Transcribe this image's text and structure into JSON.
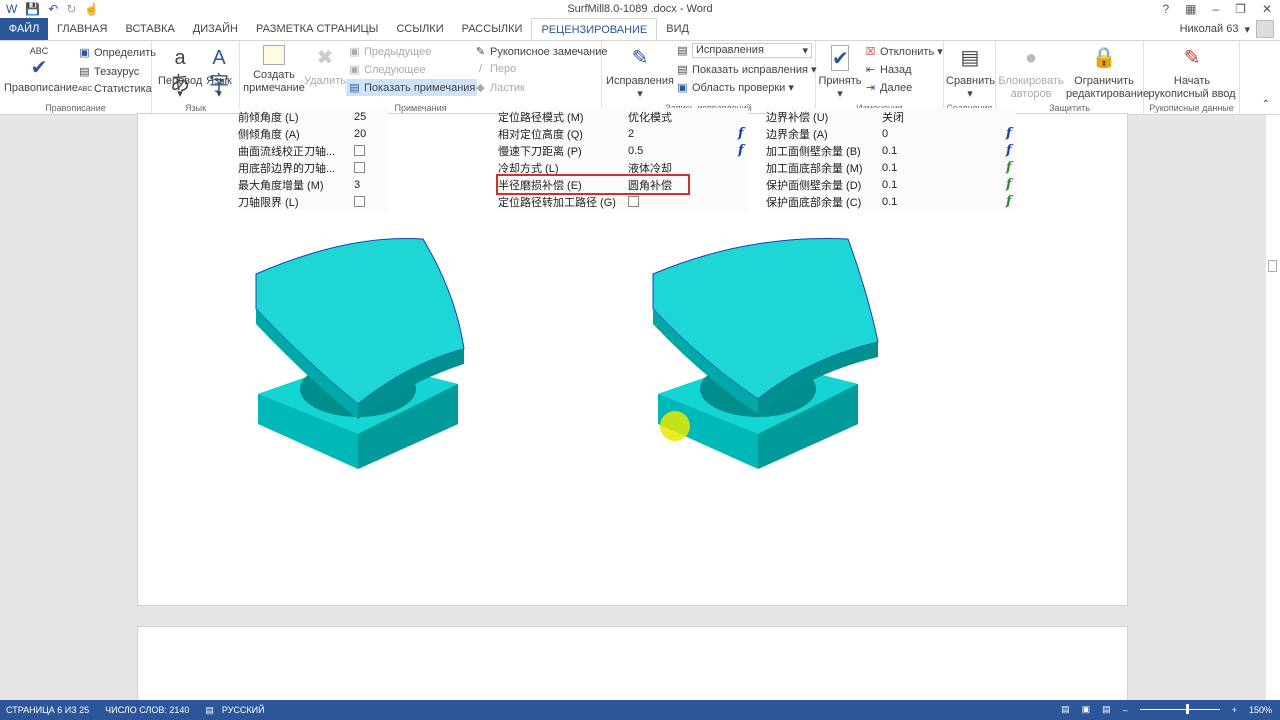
{
  "window": {
    "title": "SurfMill8.0-1089 .docx - Word",
    "user": "Николай 63"
  },
  "quick_access": [
    "word-icon",
    "save-icon",
    "undo-icon",
    "redo-icon",
    "touch-icon"
  ],
  "tabs": [
    "ФАЙЛ",
    "ГЛАВНАЯ",
    "ВСТАВКА",
    "ДИЗАЙН",
    "РАЗМЕТКА СТРАНИЦЫ",
    "ССЫЛКИ",
    "РАССЫЛКИ",
    "РЕЦЕНЗИРОВАНИЕ",
    "ВИД"
  ],
  "ribbon": {
    "spelling": {
      "label": "Правописание",
      "abc": "ABC",
      "define": "Определить",
      "thesaurus": "Тезаурус",
      "stats": "Статистика",
      "group": "Правописание"
    },
    "language": {
      "translate": "Перевод",
      "lang": "Язык",
      "group": "Язык"
    },
    "comments": {
      "create": "Создать примечание",
      "delete": "Удалить",
      "prev": "Предыдущее",
      "next": "Следующее",
      "show": "Показать примечания",
      "ink": "Рукописное замечание",
      "pen": "Перо",
      "eraser": "Ластик",
      "group": "Примечания"
    },
    "tracking": {
      "track": "Исправления",
      "display": "Исправления",
      "show_markup": "Показать исправления",
      "pane": "Область проверки",
      "group": "Запись исправлений"
    },
    "changes": {
      "accept": "Принять",
      "reject": "Отклонить",
      "back": "Назад",
      "next": "Далее",
      "group": "Изменения"
    },
    "compare": {
      "compare": "Сравнить",
      "group": "Сравнение"
    },
    "protect": {
      "block": "Блокировать авторов",
      "restrict": "Ограничить редактирование",
      "group": "Защитить"
    },
    "ink": {
      "start": "Начать рукописный ввод",
      "group": "Рукописные данные"
    }
  },
  "params": {
    "left": [
      {
        "l": "前倾角度 (L)",
        "v": "25"
      },
      {
        "l": "侧倾角度 (A)",
        "v": "20"
      },
      {
        "l": "曲面流线校正刀轴...",
        "cb": true
      },
      {
        "l": "用底部边界的刀轴...",
        "cb": true
      },
      {
        "l": "最大角度增量 (M)",
        "v": "3"
      },
      {
        "l": "刀轴限界 (L)",
        "cb": true
      }
    ],
    "mid": [
      {
        "l": "定位路径模式 (M)",
        "v": "优化模式"
      },
      {
        "l": "相对定位高度 (Q)",
        "v": "2",
        "f": true
      },
      {
        "l": "慢速下刀距离 (P)",
        "v": "0.5",
        "f": true
      },
      {
        "l": "冷却方式 (L)",
        "v": "液体冷却"
      },
      {
        "l": "半径磨损补偿 (E)",
        "v": "圆角补偿",
        "hl": true
      },
      {
        "l": "定位路径转加工路径 (G)",
        "cb": true
      }
    ],
    "right": [
      {
        "l": "边界补偿 (U)",
        "v": "关闭"
      },
      {
        "l": "边界余量 (A)",
        "v": "0",
        "f": true
      },
      {
        "l": "加工面侧壁余量 (B)",
        "v": "0.1",
        "f": true
      },
      {
        "l": "加工面底部余量 (M)",
        "v": "0.1",
        "f": true,
        "g": true
      },
      {
        "l": "保护面侧壁余量 (D)",
        "v": "0.1",
        "f": true,
        "g": true
      },
      {
        "l": "保护面底部余量 (C)",
        "v": "0.1",
        "f": true,
        "g": true
      }
    ]
  },
  "status": {
    "page": "СТРАНИЦА 6 ИЗ 25",
    "words": "ЧИСЛО СЛОВ: 2140",
    "lang": "РУССКИЙ",
    "zoom": "150%"
  },
  "colors": {
    "accent": "#2b579a",
    "model": "#00c8c8",
    "highlight": "#d32f2f"
  }
}
